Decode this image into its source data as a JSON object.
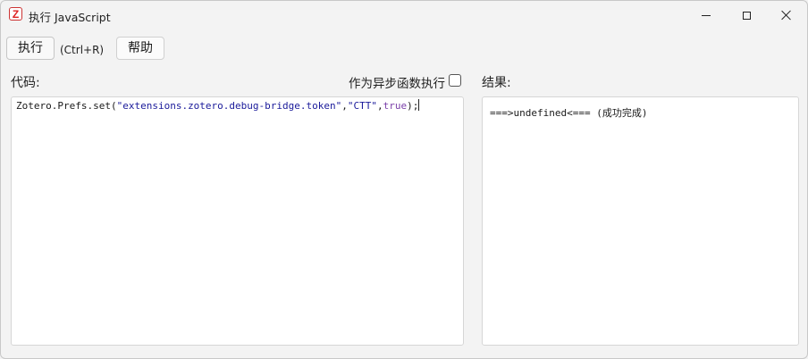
{
  "window": {
    "title": "执行 JavaScript",
    "app_icon": "zotero-icon",
    "app_icon_letter": "Z"
  },
  "toolbar": {
    "run_label": "执行",
    "shortcut": "(Ctrl+R)",
    "help_label": "帮助"
  },
  "code_panel": {
    "label": "代码:",
    "async_label": "作为异步函数执行",
    "async_checked": false,
    "code": {
      "prefix": "Zotero.Prefs.set(",
      "arg1": "\"extensions.zotero.debug-bridge.token\"",
      "comma1": ",",
      "arg2": "\"CTT\"",
      "comma2": ",",
      "arg3": "true",
      "suffix": ");"
    }
  },
  "result_panel": {
    "label": "结果:",
    "output": "===>undefined<=== (成功完成)"
  }
}
